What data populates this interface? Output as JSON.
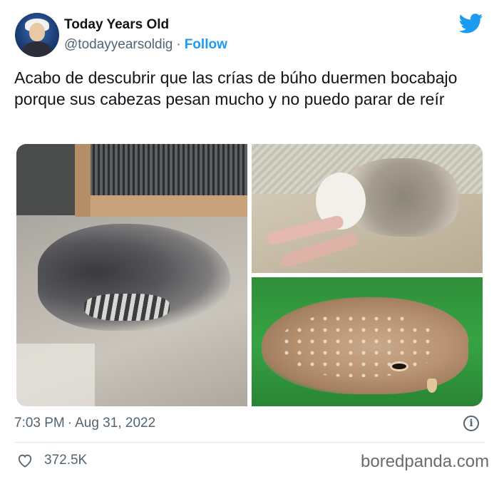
{
  "author": {
    "name": "Today Years Old",
    "handle": "@todayyearsoldig",
    "separator": "·",
    "follow_label": "Follow"
  },
  "tweet": {
    "text": "Acabo de descubrir que las crías de búho duermen bocabajo porque sus cabezas pesan mucho y no puedo parar de reír",
    "time": "7:03 PM",
    "separator": "·",
    "date": "Aug 31, 2022",
    "info_glyph": "i",
    "like_count": "372.5K"
  },
  "media": {
    "photos": [
      "owl-chick-sleeping-face-down-on-sand",
      "owl-chick-sleeping-on-blanket",
      "owl-sleeping-on-green-turf"
    ]
  },
  "icons": {
    "platform": "twitter-bird-icon",
    "info": "info-icon",
    "like": "heart-icon"
  },
  "colors": {
    "brand_blue": "#1d9bf0",
    "text_primary": "#0f1419",
    "text_secondary": "#536471"
  },
  "watermark": {
    "text": "boredpanda.com"
  }
}
